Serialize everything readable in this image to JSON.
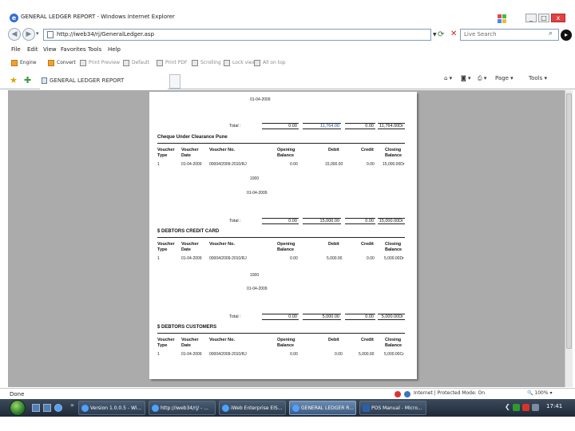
{
  "window": {
    "title": "GENERAL LEDGER REPORT - Windows Internet Explorer",
    "minimize": "_",
    "maximize": "□",
    "close": "x"
  },
  "address": {
    "url": "http://iweb34/rj/GeneralLedger.asp",
    "search_placeholder": "Live Search"
  },
  "menu": [
    "File",
    "Edit",
    "View",
    "Favorites",
    "Tools",
    "Help"
  ],
  "links": {
    "engine": "Engine",
    "convert": "Convert",
    "print_preview": "Print Preview",
    "default": "Default",
    "print_pdf": "Print PDF",
    "scrolling": "Scrolling",
    "lock_view": "Lock view",
    "all_on_top": "All on top"
  },
  "tab": {
    "label": "GENERAL LEDGER REPORT"
  },
  "commands": {
    "page": "Page",
    "tools": "Tools"
  },
  "report": {
    "top_date": "01-04-2009",
    "total_label": "Total :",
    "sec1": {
      "totals": [
        "0.00",
        "11,764.00",
        "0.00",
        "11,764.00Dr"
      ]
    },
    "sec2": {
      "title": "Cheque Under Clearance Pune",
      "headers": [
        "Voucher",
        "Voucher",
        "Voucher No.",
        "Opening",
        "Debit",
        "Credit",
        "Closing",
        "Type",
        "Date",
        "Balance",
        "Balance"
      ],
      "row": [
        "1",
        "01-04-2009",
        "00004/2009-2010/RJ",
        "0.00",
        "15,000.00",
        "0.00",
        "15,000.00Dr"
      ],
      "code": "1000",
      "date": "01-04-2009",
      "totals": [
        "0.00",
        "15,000.00",
        "0.00",
        "15,000.00Dr"
      ]
    },
    "sec3": {
      "title": "$ DEBTORS CREDIT CARD",
      "headers": [
        "Voucher",
        "Voucher",
        "Voucher No.",
        "Opening",
        "Debit",
        "Credit",
        "Closing",
        "Type",
        "Date",
        "Balance",
        "Balance"
      ],
      "row": [
        "1",
        "01-04-2009",
        "00004/2009-2010/RJ",
        "0.00",
        "5,000.00",
        "0.00",
        "5,000.00Dr"
      ],
      "code": "1000",
      "date": "01-04-2009",
      "totals": [
        "0.00",
        "5,000.00",
        "0.00",
        "5,000.00Dr"
      ]
    },
    "sec4": {
      "title": "$ DEBTORS CUSTOMERS",
      "headers": [
        "Voucher",
        "Voucher",
        "Voucher No.",
        "Opening",
        "Debit",
        "Credit",
        "Closing",
        "Type",
        "Date",
        "Balance",
        "Balance"
      ],
      "row": [
        "1",
        "01-04-2009",
        "00004/2009-2010/RJ",
        "0.00",
        "0.00",
        "5,000.00",
        "5,000.00Cr"
      ]
    }
  },
  "status": {
    "text": "Done",
    "zone": "Internet | Protected Mode: On",
    "zoom": "100%"
  },
  "taskbar": {
    "buttons": [
      "Version 1.0.0.5 - Wi...",
      "http://iweb34/rj/ - ...",
      "iWeb Enterprise EIS...",
      "GENERAL LEDGER R...",
      "POS Manual - Micro..."
    ],
    "time": "17:41"
  }
}
